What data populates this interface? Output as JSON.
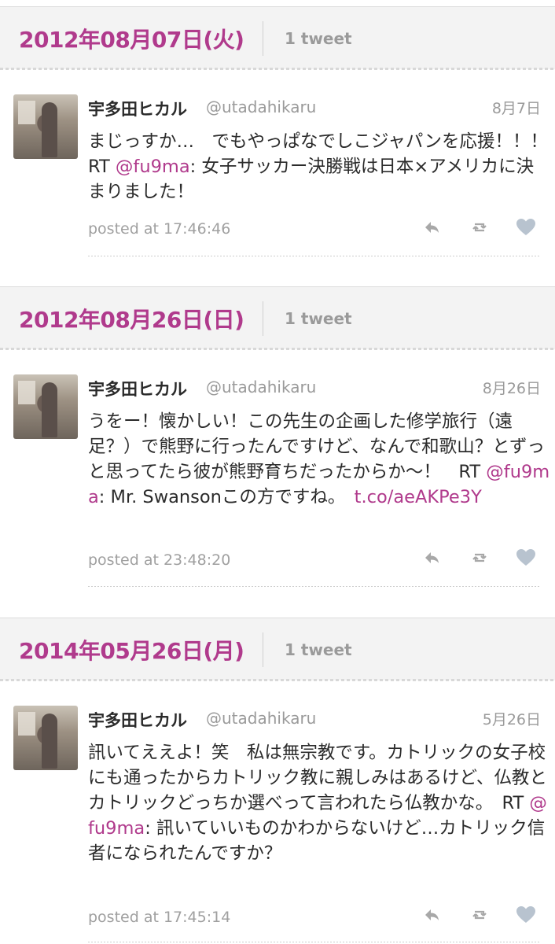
{
  "days": [
    {
      "date": "2012年08月07日(火)",
      "count": "1 tweet",
      "tweet": {
        "name": "宇多田ヒカル",
        "handle": "@utadahikaru",
        "date": "8月7日",
        "text_before": "まじっすか…　でもやっぱなでしこジャパンを応援！！！　RT ",
        "mention": "@fu9ma",
        "text_after": ": 女子サッカー決勝戦は日本×アメリカに決まりました！",
        "link": "",
        "posted": "posted at 17:46:46"
      }
    },
    {
      "date": "2012年08月26日(日)",
      "count": "1 tweet",
      "tweet": {
        "name": "宇多田ヒカル",
        "handle": "@utadahikaru",
        "date": "8月26日",
        "text_before": "うをー！懐かしい！この先生の企画した修学旅行（遠足？）で熊野に行ったんですけど、なんで和歌山？とずっと思ってたら彼が熊野育ちだったからか〜！　RT ",
        "mention": "@fu9ma",
        "text_after": ": Mr. Swansonこの方ですね。　",
        "link": "t.co/aeAKPe3Y",
        "posted": "posted at 23:48:20"
      }
    },
    {
      "date": "2014年05月26日(月)",
      "count": "1 tweet",
      "tweet": {
        "name": "宇多田ヒカル",
        "handle": "@utadahikaru",
        "date": "5月26日",
        "text_before": "訊いてええよ！笑　私は無宗教です。カトリックの女子校にも通ったからカトリック教に親しみはあるけど、仏教とカトリックどっちか選べって言われたら仏教かな。　RT ",
        "mention": "@fu9ma",
        "text_after": ": 訊いていいものかわからないけど…カトリック信者になられたんですか？",
        "link": "",
        "posted": "posted at 17:45:14"
      }
    }
  ],
  "icons": {
    "reply": "reply-icon",
    "retweet": "retweet-icon",
    "like": "heart-icon"
  },
  "colors": {
    "accent": "#b03a8c",
    "muted": "#9a9a9a",
    "header_bg": "#f3f3f3"
  }
}
